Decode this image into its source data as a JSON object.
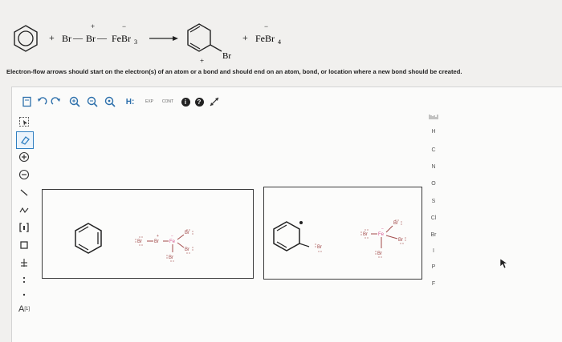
{
  "reaction": {
    "reactant_plus": "+",
    "br_left": "Br",
    "bond_1": "—",
    "br_middle": "Br",
    "br_middle_charge": "+",
    "bond_2": "—",
    "febr3": "FeBr",
    "febr3_sub": "3",
    "febr3_charge": "−",
    "product_bromo": "Br",
    "product_charge": "+",
    "product_plus": "+",
    "febr4": "FeBr",
    "febr4_sub": "4",
    "febr4_charge": "−"
  },
  "instructions": "Electron-flow arrows should start on the electron(s) of an atom or a bond and should end on an atom, bond, or location where a new bond should be created.",
  "toolbar": {
    "h_label": "H:",
    "exp_label": "EXP",
    "cont_label": "CONT",
    "info_icon": "i",
    "help_icon": "?"
  },
  "left_tools": {
    "template_label": "A",
    "template_sup": "[1]"
  },
  "element_list": [
    "H",
    "C",
    "N",
    "O",
    "S",
    "Cl",
    "Br",
    "I",
    "P",
    "F"
  ],
  "left_panel": {
    "br_a": "Br",
    "br_b": "Br",
    "fe": "Fe",
    "br_c": "Br",
    "br_d": "Br",
    "br_e": "Br",
    "charge_plus": "+",
    "charge_minus": "−"
  },
  "right_panel": {
    "br_on_ring": "Br",
    "br_a": "Br",
    "fe": "Fe",
    "br_b": "Br",
    "br_c": "Br",
    "br_d": "Br",
    "charge_minus": "−"
  },
  "colors": {
    "accent_blue": "#2f7fc1",
    "fe_pink": "#d5548f",
    "br_red": "#a24a4a",
    "panel_border": "#3b3b3b",
    "toolbar_icon": "#2c6fab"
  }
}
